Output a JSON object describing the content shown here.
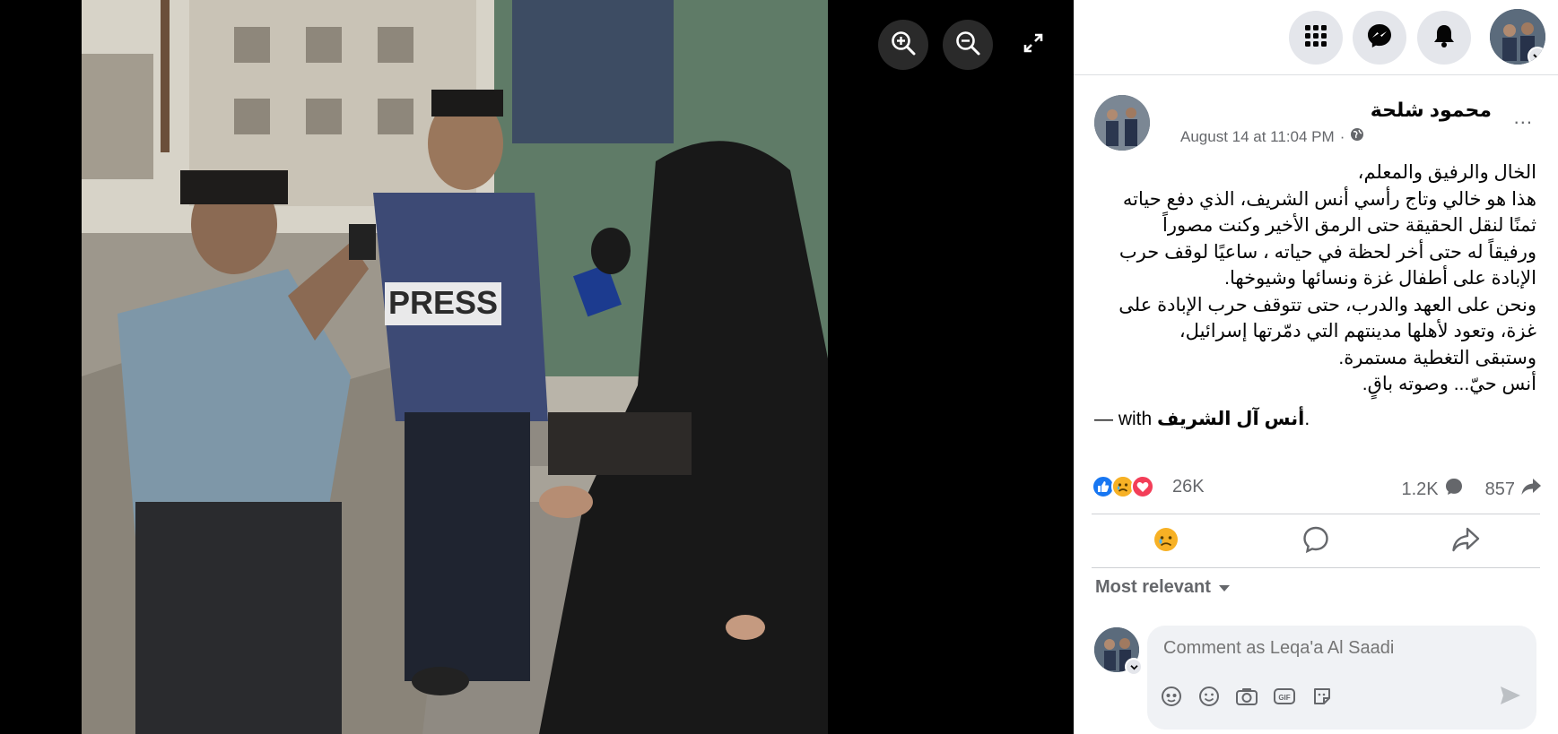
{
  "viewer": {
    "zoom_in_icon": "zoom-in-icon",
    "zoom_out_icon": "zoom-out-icon",
    "fullscreen_icon": "expand-icon",
    "photo_text": {
      "vest": "PRESS"
    }
  },
  "topbar": {
    "icons": [
      "menu-grid-icon",
      "messenger-icon",
      "bell-icon",
      "profile-avatar"
    ]
  },
  "post": {
    "author": "محمود شلحة",
    "timestamp": "August 14 at 11:04 PM",
    "audience_icon": "globe-icon",
    "more_label": "...",
    "text_lines": [
      "الخال والرفيق والمعلم،",
      "هذا هو خالي وتاج رأسي أنس الشريف، الذي دفع حياته",
      "ثمنًا لنقل الحقيقة حتى الرمق الأخير وكنت مصوراً",
      "ورفيقاً له حتى أخر لحظة في حياته ، ساعيًا لوقف حرب",
      "الإبادة على أطفال غزة ونسائها وشيوخها.",
      "ونحن على العهد والدرب، حتى تتوقف حرب الإبادة على",
      "غزة، وتعود لأهلها مدينتهم التي دمّرتها إسرائيل،",
      "وستبقى التغطية مستمرة.",
      "أنس حيّ... وصوته باقٍ."
    ],
    "with_prefix": "— with",
    "tagged_name": "أنس آل الشريف",
    "with_suffix": ".",
    "reactions_count": "26K",
    "comments_count": "1.2K",
    "shares_count": "857",
    "colors": {
      "like": "#1877f2",
      "love": "#f33e58",
      "sad": "#f7b125"
    }
  },
  "actions": {
    "icons": [
      "sad-reaction-icon",
      "comment-icon",
      "share-icon"
    ]
  },
  "comments": {
    "sort_label": "Most relevant",
    "placeholder": "Comment as Leqa'a Al Saadi",
    "tool_icons": [
      "avatar-sticker-icon",
      "emoji-icon",
      "camera-icon",
      "gif-icon",
      "sticker-icon"
    ],
    "send_icon": "send-icon"
  }
}
